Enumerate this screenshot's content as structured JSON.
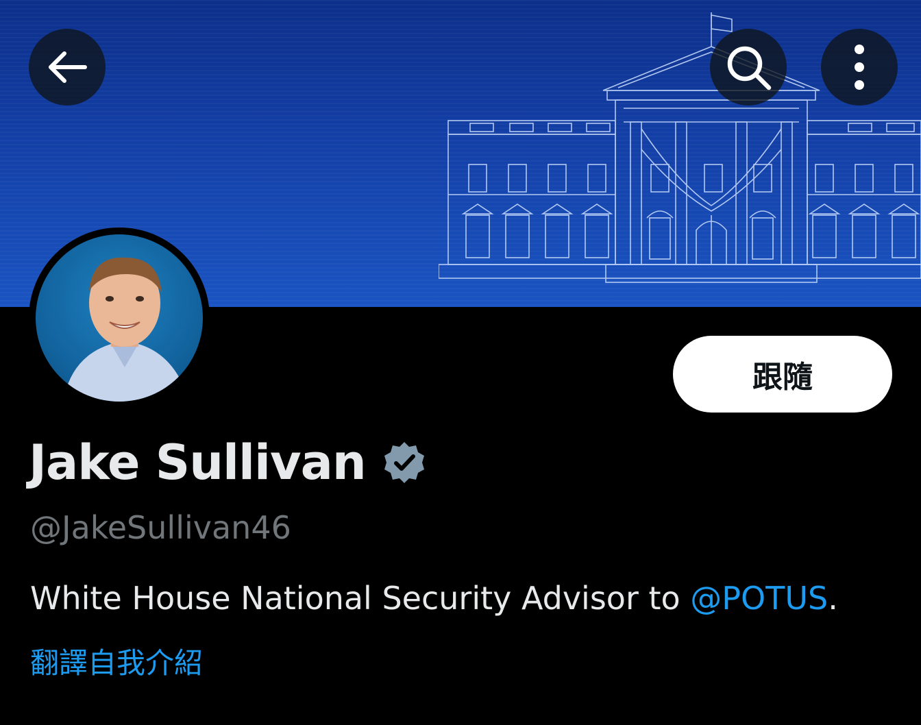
{
  "header": {
    "back_icon": "arrow-left-icon",
    "search_icon": "search-icon",
    "more_icon": "more-vertical-icon"
  },
  "banner": {
    "image": "white-house-blueprint-illustration",
    "colors": {
      "top": "#0c2f8a",
      "bottom": "#1a54c2",
      "lines": "#cfe0ff"
    }
  },
  "profile": {
    "avatar": "profile-photo",
    "display_name": "Jake Sullivan",
    "verified_icon": "verified-badge-icon",
    "handle": "@JakeSullivan46",
    "bio_text": "White House National Security Advisor to ",
    "bio_mention": "@POTUS",
    "bio_suffix": ".",
    "translate_label": "翻譯自我介紹"
  },
  "actions": {
    "follow_label": "跟隨"
  },
  "colors": {
    "background": "#000000",
    "primary_text": "#e7e9ea",
    "secondary_text": "#71767b",
    "link": "#1d9bf0",
    "verified": "#829aab"
  }
}
